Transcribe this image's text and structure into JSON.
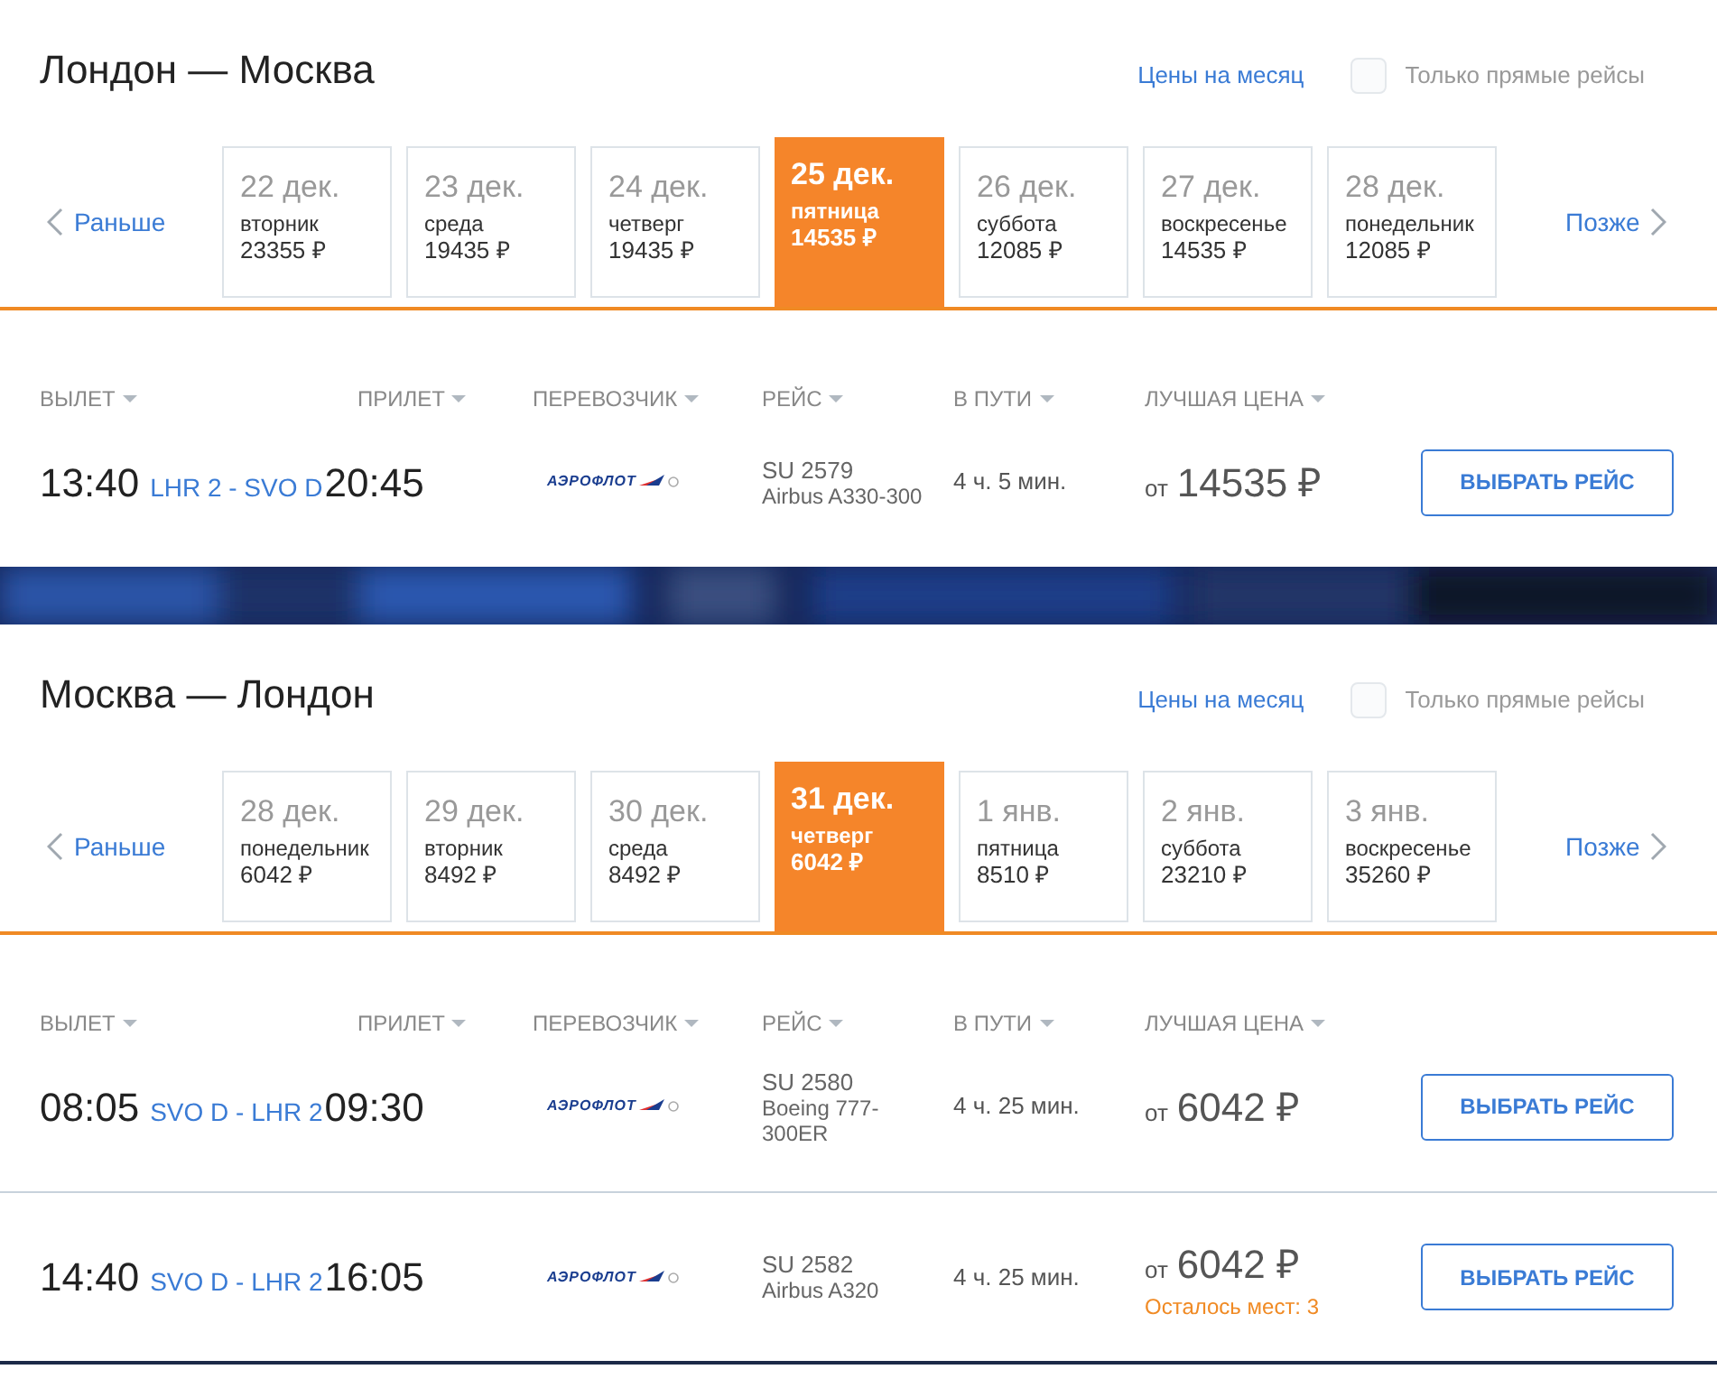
{
  "sections": [
    {
      "title": "Лондон — Москва",
      "month_link": "Цены на месяц",
      "direct_only": {
        "label": "Только прямые рейсы",
        "checked": false
      },
      "earlier": "Раньше",
      "later": "Позже",
      "dates": [
        {
          "date": "22 дек.",
          "weekday": "вторник",
          "price": "23355 ₽",
          "selected": false
        },
        {
          "date": "23 дек.",
          "weekday": "среда",
          "price": "19435 ₽",
          "selected": false
        },
        {
          "date": "24 дек.",
          "weekday": "четверг",
          "price": "19435 ₽",
          "selected": false
        },
        {
          "date": "25 дек.",
          "weekday": "пятница",
          "price": "14535 ₽",
          "selected": true
        },
        {
          "date": "26 дек.",
          "weekday": "суббота",
          "price": "12085 ₽",
          "selected": false
        },
        {
          "date": "27 дек.",
          "weekday": "воскресенье",
          "price": "14535 ₽",
          "selected": false
        },
        {
          "date": "28 дек.",
          "weekday": "понедельник",
          "price": "12085 ₽",
          "selected": false
        }
      ],
      "columns": [
        "ВЫЛЕТ",
        "ПРИЛЕТ",
        "ПЕРЕВОЗЧИК",
        "РЕЙС",
        "В ПУТИ",
        "ЛУЧШАЯ ЦЕНА"
      ],
      "flights": [
        {
          "depart": "13:40",
          "route": "LHR 2 - SVO D",
          "arrive": "20:45",
          "airline": "АЭРОФЛОТ",
          "flight_no": "SU 2579",
          "aircraft": "Airbus A330-300",
          "duration": "4 ч. 5 мин.",
          "price_prefix": "от",
          "price": "14535 ₽",
          "button": "ВЫБРАТЬ РЕЙС"
        }
      ]
    },
    {
      "title": "Москва — Лондон",
      "month_link": "Цены на месяц",
      "direct_only": {
        "label": "Только прямые рейсы",
        "checked": false
      },
      "earlier": "Раньше",
      "later": "Позже",
      "dates": [
        {
          "date": "28 дек.",
          "weekday": "понедельник",
          "price": "6042 ₽",
          "selected": false
        },
        {
          "date": "29 дек.",
          "weekday": "вторник",
          "price": "8492 ₽",
          "selected": false
        },
        {
          "date": "30 дек.",
          "weekday": "среда",
          "price": "8492 ₽",
          "selected": false
        },
        {
          "date": "31 дек.",
          "weekday": "четверг",
          "price": "6042 ₽",
          "selected": true
        },
        {
          "date": "1 янв.",
          "weekday": "пятница",
          "price": "8510 ₽",
          "selected": false
        },
        {
          "date": "2 янв.",
          "weekday": "суббота",
          "price": "23210 ₽",
          "selected": false
        },
        {
          "date": "3 янв.",
          "weekday": "воскресенье",
          "price": "35260 ₽",
          "selected": false
        }
      ],
      "columns": [
        "ВЫЛЕТ",
        "ПРИЛЕТ",
        "ПЕРЕВОЗЧИК",
        "РЕЙС",
        "В ПУТИ",
        "ЛУЧШАЯ ЦЕНА"
      ],
      "flights": [
        {
          "depart": "08:05",
          "route": "SVO D - LHR 2",
          "arrive": "09:30",
          "airline": "АЭРОФЛОТ",
          "flight_no": "SU 2580",
          "aircraft": "Boeing 777-300ER",
          "duration": "4 ч. 25 мин.",
          "price_prefix": "от",
          "price": "6042 ₽",
          "button": "ВЫБРАТЬ РЕЙС"
        },
        {
          "depart": "14:40",
          "route": "SVO D - LHR 2",
          "arrive": "16:05",
          "airline": "АЭРОФЛОТ",
          "flight_no": "SU 2582",
          "aircraft": "Airbus A320",
          "duration": "4 ч. 25 мин.",
          "price_prefix": "от",
          "price": "6042 ₽",
          "note": "Осталось мест: 3",
          "button": "ВЫБРАТЬ РЕЙС"
        }
      ]
    }
  ]
}
